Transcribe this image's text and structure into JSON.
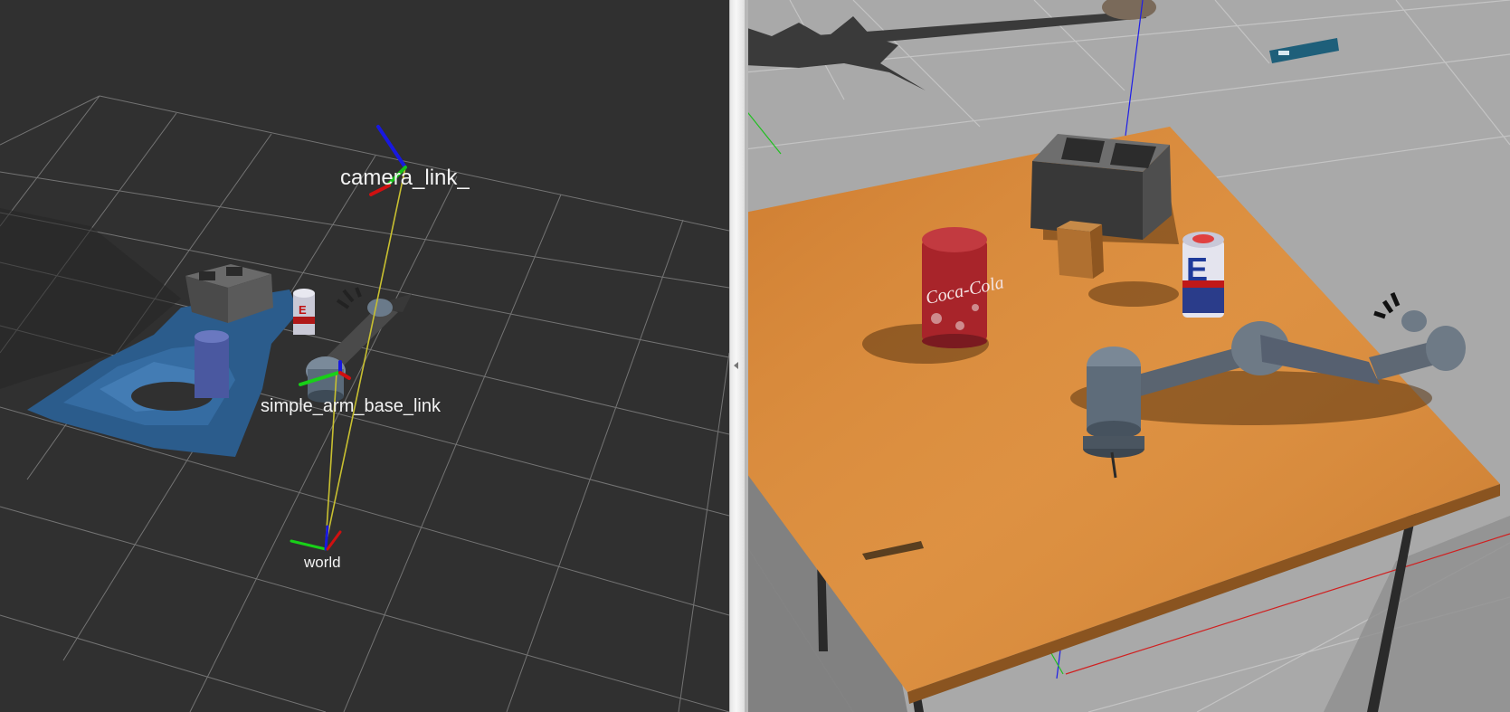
{
  "rviz": {
    "frames": {
      "camera_link": "camera_link_",
      "arm_base_link": "simple_arm_base_link",
      "world": "world"
    }
  },
  "gazebo": {
    "can_left_brand": "Coca-Cola",
    "can_right_letter": "E"
  },
  "colors": {
    "rviz_background": "#303030",
    "grid": "#8a8a8a",
    "axis_x": "#d01010",
    "axis_y": "#10d010",
    "axis_z": "#1010e0",
    "tf_link": "#c8c030",
    "table_wood": "#d88a3a",
    "gazebo_ground": "#a9a9a9"
  }
}
